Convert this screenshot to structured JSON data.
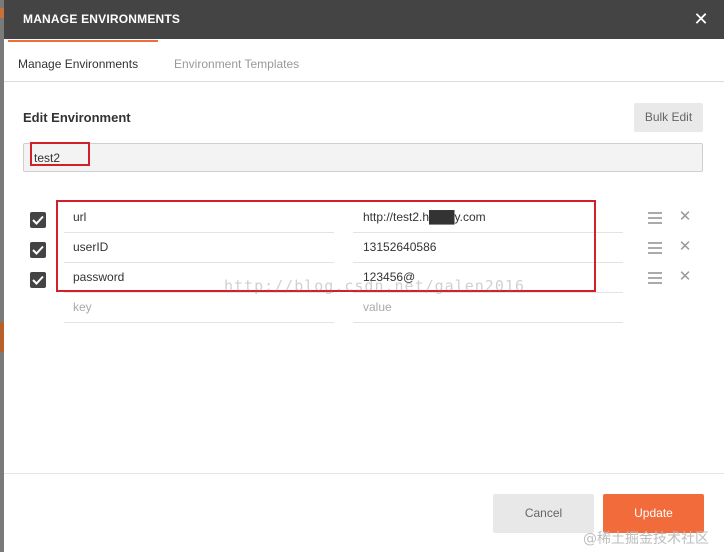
{
  "modal": {
    "title": "MANAGE ENVIRONMENTS",
    "close_icon": "close-icon"
  },
  "tabs": [
    {
      "label": "Manage Environments",
      "active": true
    },
    {
      "label": "Environment Templates",
      "active": false
    }
  ],
  "edit": {
    "section_title": "Edit Environment",
    "bulk_edit_label": "Bulk Edit",
    "env_name": "test2"
  },
  "variables": [
    {
      "enabled": true,
      "key": "url",
      "value": "http://test2.h███y.com"
    },
    {
      "enabled": true,
      "key": "userID",
      "value": "13152640586"
    },
    {
      "enabled": true,
      "key": "password",
      "value": "123456@"
    }
  ],
  "new_row": {
    "key_placeholder": "key",
    "value_placeholder": "value"
  },
  "footer": {
    "cancel_label": "Cancel",
    "update_label": "Update"
  },
  "watermark": "http://blog.csdn.net/galen2016",
  "corner_watermark": "@稀土掘金技术社区",
  "colors": {
    "header_bg": "#444444",
    "accent": "#f26b3a",
    "highlight": "#d2202a"
  }
}
